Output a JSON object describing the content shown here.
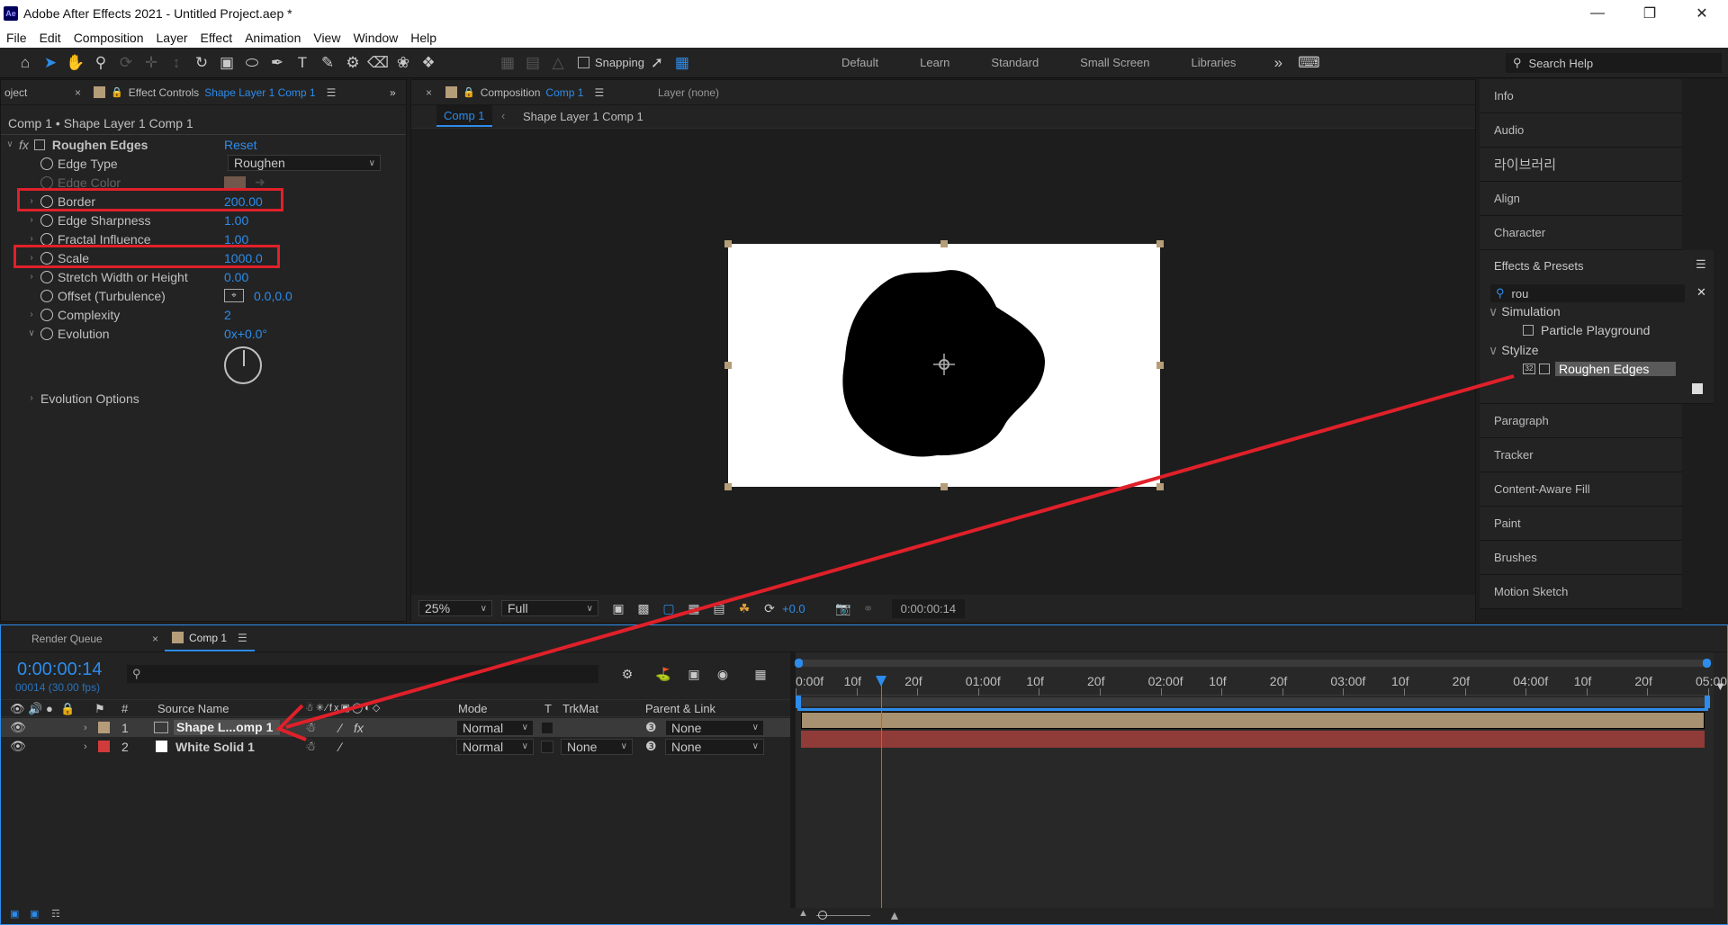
{
  "window": {
    "title": "Adobe After Effects 2021 - Untitled Project.aep *",
    "app_icon": "Ae"
  },
  "menu": [
    "File",
    "Edit",
    "Composition",
    "Layer",
    "Effect",
    "Animation",
    "View",
    "Window",
    "Help"
  ],
  "toolbar": {
    "snapping_label": "Snapping",
    "workspaces": [
      "Default",
      "Learn",
      "Standard",
      "Small Screen",
      "Libraries"
    ],
    "search_help_placeholder": "Search Help"
  },
  "effect_controls": {
    "project_tab": "oject",
    "tab_label": "Effect Controls",
    "tab_layer": "Shape Layer 1 Comp 1",
    "breadcrumb": "Comp 1 • Shape Layer 1 Comp 1",
    "effect_name": "Roughen Edges",
    "fx": "fx",
    "reset": "Reset",
    "properties": [
      {
        "label": "Edge Type",
        "value": "Roughen"
      },
      {
        "label": "Edge Color",
        "value": ""
      },
      {
        "label": "Border",
        "value": "200.00"
      },
      {
        "label": "Edge Sharpness",
        "value": "1.00"
      },
      {
        "label": "Fractal Influence",
        "value": "1.00"
      },
      {
        "label": "Scale",
        "value": "1000.0"
      },
      {
        "label": "Stretch Width or Height",
        "value": "0.00"
      },
      {
        "label": "Offset (Turbulence)",
        "value": "0.0,0.0"
      },
      {
        "label": "Complexity",
        "value": "2"
      },
      {
        "label": "Evolution",
        "value": "0x+0.0°"
      }
    ],
    "evolution_options": "Evolution Options"
  },
  "composition": {
    "tab_label": "Composition",
    "tab_comp": "Comp 1",
    "layer_tab": "Layer (none)",
    "breadcrumb_active": "Comp 1",
    "breadcrumb_next": "Shape Layer 1 Comp 1",
    "zoom": "25%",
    "resolution": "Full",
    "exposure": "+0.0",
    "timecode": "0:00:00:14"
  },
  "right_panels": {
    "items_top": [
      "Info",
      "Audio",
      "라이브러리",
      "Align",
      "Character"
    ],
    "effects_presets": {
      "title": "Effects & Presets",
      "search": "rou",
      "groups": [
        {
          "name": "Simulation",
          "items": [
            "Particle Playground"
          ]
        },
        {
          "name": "Stylize",
          "items": [
            "Roughen Edges"
          ]
        }
      ]
    },
    "items_bottom": [
      "Paragraph",
      "Tracker",
      "Content-Aware Fill",
      "Paint",
      "Brushes",
      "Motion Sketch"
    ]
  },
  "timeline": {
    "tabs": [
      "Render Queue",
      "Comp 1"
    ],
    "timecode": "0:00:00:14",
    "fps": "00014 (30.00 fps)",
    "columns": {
      "num": "#",
      "source": "Source Name",
      "mode": "Mode",
      "t": "T",
      "trkmat": "TrkMat",
      "parent": "Parent & Link"
    },
    "layers": [
      {
        "num": "1",
        "name": "Shape L...omp 1",
        "mode": "Normal",
        "trkmat": "",
        "parent": "None",
        "label_color": "#b59d7a"
      },
      {
        "num": "2",
        "name": "White Solid 1",
        "mode": "Normal",
        "trkmat": "None",
        "parent": "None",
        "label_color": "#d13b3b"
      }
    ],
    "ruler_labels": [
      "0:00f",
      "10f",
      "20f",
      "01:00f",
      "10f",
      "20f",
      "02:00f",
      "10f",
      "20f",
      "03:00f",
      "10f",
      "20f",
      "04:00f",
      "10f",
      "20f",
      "05:00"
    ],
    "playhead_frames": 14
  }
}
